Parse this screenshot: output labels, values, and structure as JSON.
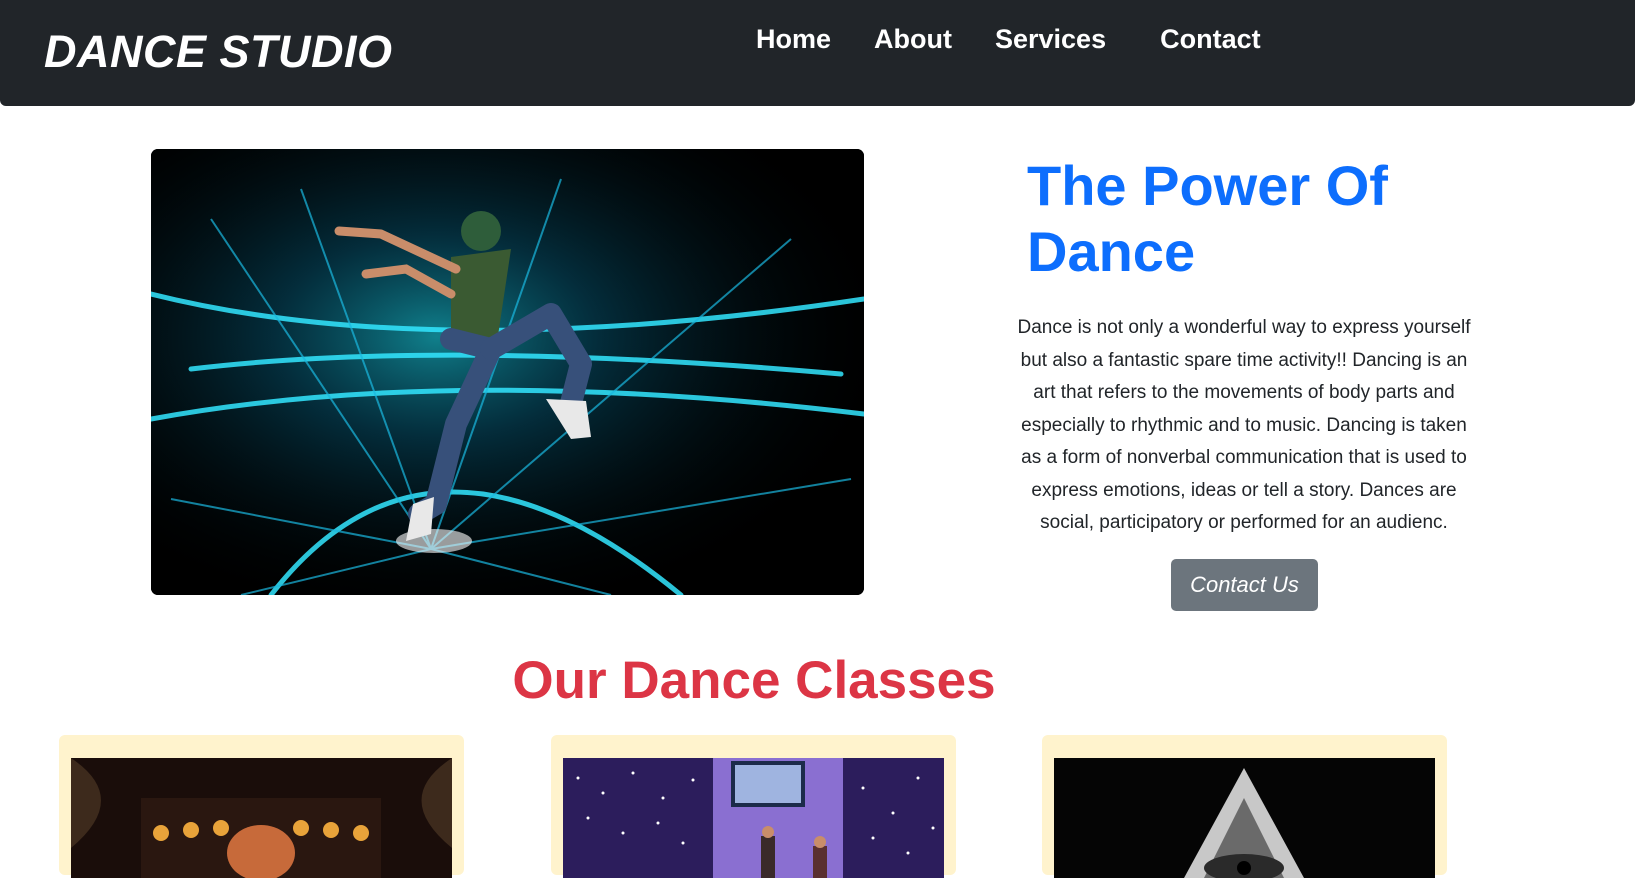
{
  "navbar": {
    "brand": "DANCE STUDIO",
    "links": [
      "Home",
      "About",
      "Services",
      "Contact"
    ]
  },
  "hero": {
    "image_icon": "dancer-photo",
    "title": "The Power Of Dance",
    "text": "Dance is not only a wonderful way to express yourself but also a fantastic spare time activity!! Dancing is an art that refers to the movements of body parts and especially to rhythmic and to music. Dancing is taken as a form of nonverbal communication that is used to express emotions, ideas or tell a story. Dances are social, participatory or performed for an audienc.",
    "button_label": "Contact Us"
  },
  "classes": {
    "title": "Our Dance Classes",
    "cards": [
      {
        "image_icon": "stage-photo"
      },
      {
        "image_icon": "club-photo"
      },
      {
        "image_icon": "pyramid-photo"
      }
    ]
  },
  "colors": {
    "navbar": "#212529",
    "title_blue": "#0d6efd",
    "section_red": "#dc3545",
    "button_gray": "#6c757d",
    "card_bg": "#fff3cd"
  }
}
